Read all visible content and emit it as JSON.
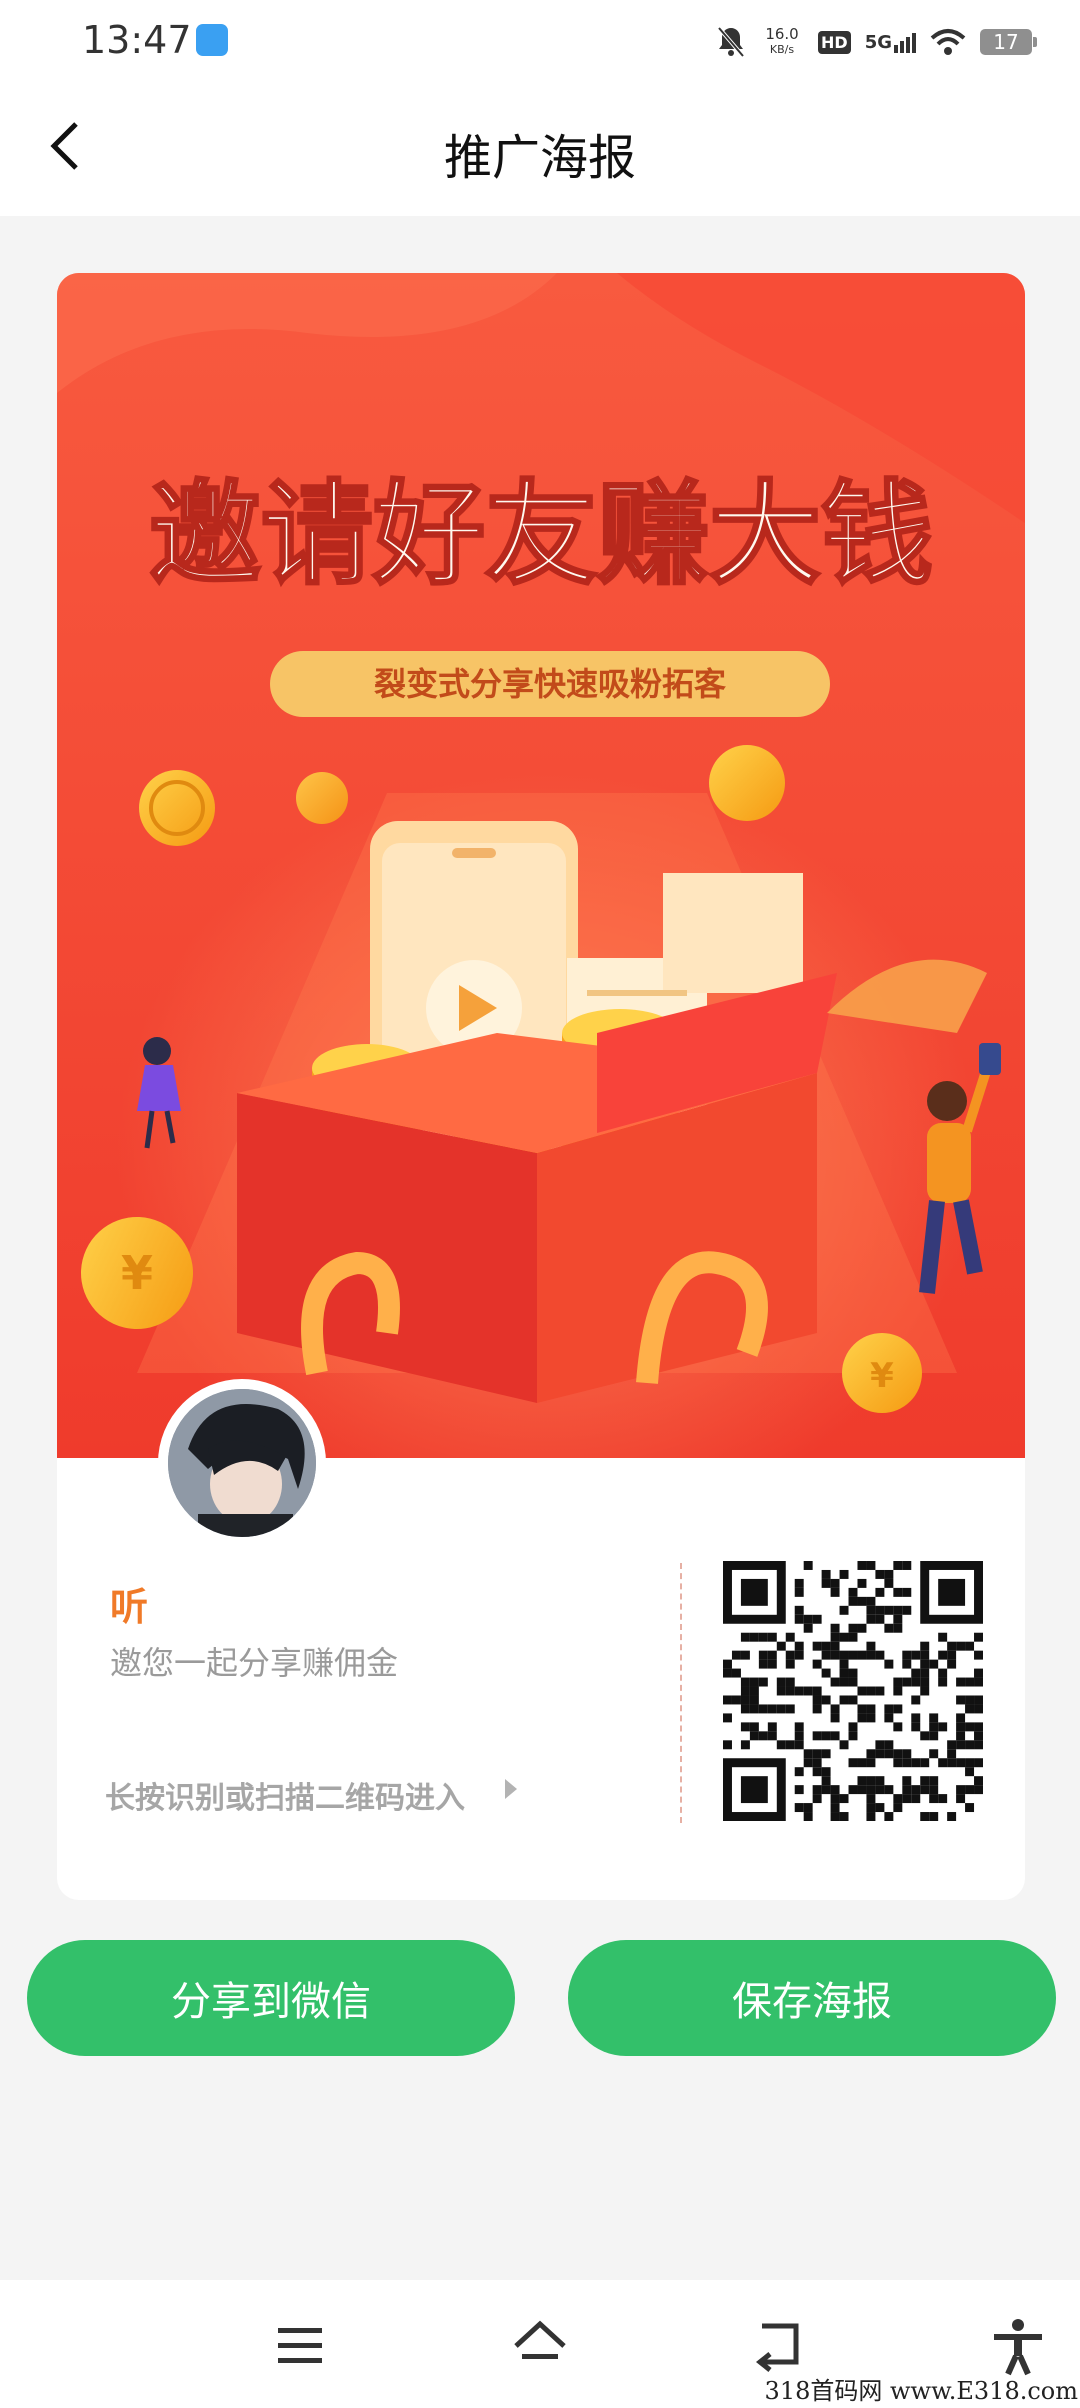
{
  "status_bar": {
    "time": "13:47",
    "speed_value": "16.0",
    "speed_unit": "KB/s",
    "hd": "HD",
    "network": "5G",
    "battery": "17"
  },
  "header": {
    "title": "推广海报"
  },
  "poster": {
    "headline": "邀请好友赚大钱",
    "tagline": "裂变式分享快速吸粉拓客",
    "user_name": "听",
    "invite_text": "邀您一起分享赚佣金",
    "qr_hint": "长按识别或扫描二维码进入"
  },
  "buttons": {
    "share": "分享到微信",
    "save": "保存海报"
  },
  "watermark": "318首码网 www.E318.com",
  "colors": {
    "accent_green": "#33c06a",
    "poster_red": "#f24a35",
    "tagline_gold": "#f7c466",
    "username_orange": "#f07a28"
  },
  "icons": [
    "back-arrow-icon",
    "mute-icon",
    "signal-icon",
    "wifi-icon",
    "menu-icon",
    "home-icon",
    "back-icon",
    "accessibility-icon"
  ]
}
